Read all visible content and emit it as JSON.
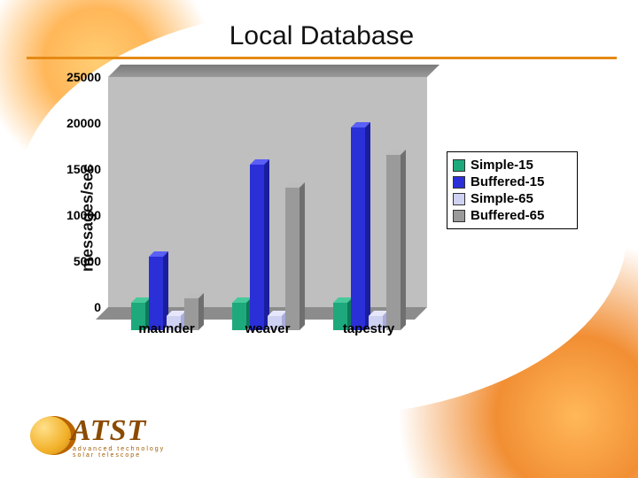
{
  "title": "Local Database",
  "chart_data": {
    "type": "bar",
    "ylabel": "messages/sec",
    "xlabel": "",
    "ylim": [
      0,
      25000
    ],
    "yticks": [
      0,
      5000,
      10000,
      15000,
      20000,
      25000
    ],
    "categories": [
      "maunder",
      "weaver",
      "tapestry"
    ],
    "series": [
      {
        "name": "Simple-15",
        "color": "#1ea97c",
        "colorTop": "#48c99b",
        "colorSide": "#0e7a58",
        "values": [
          3000,
          3000,
          3000
        ]
      },
      {
        "name": "Buffered-15",
        "color": "#2a2fd8",
        "colorTop": "#5a5ff5",
        "colorSide": "#1a1e9e",
        "values": [
          8000,
          18000,
          22000
        ]
      },
      {
        "name": "Simple-65",
        "color": "#cfd1f2",
        "colorTop": "#e6e7fb",
        "colorSide": "#a9abdc",
        "values": [
          1500,
          1500,
          1500
        ]
      },
      {
        "name": "Buffered-65",
        "color": "#9a9a9a",
        "colorTop": "#bdbdbd",
        "colorSide": "#6f6f6f",
        "values": [
          3500,
          15500,
          19000
        ]
      }
    ]
  },
  "legend": {
    "items": [
      "Simple-15",
      "Buffered-15",
      "Simple-65",
      "Buffered-65"
    ]
  },
  "logo": {
    "word": "ATST",
    "tagline": "advanced technology solar telescope"
  }
}
